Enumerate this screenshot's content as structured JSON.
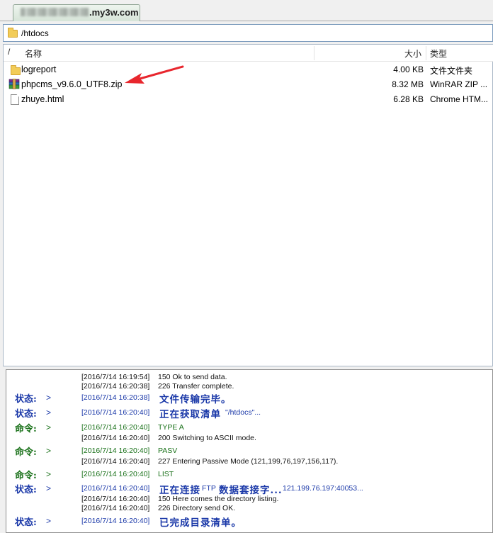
{
  "tab": {
    "label": ".my3w.com"
  },
  "pathbar": {
    "path": "/htdocs"
  },
  "filelist": {
    "sort_indicator": "/",
    "columns": {
      "name": "名称",
      "size": "大小",
      "type": "类型"
    },
    "rows": [
      {
        "name": "logreport",
        "size": "4.00 KB",
        "type": "文件文件夹",
        "icon": "folder-icon"
      },
      {
        "name": "phpcms_v9.6.0_UTF8.zip",
        "size": "8.32 MB",
        "type": "WinRAR ZIP ...",
        "icon": "rar-archive-icon"
      },
      {
        "name": "zhuye.html",
        "size": "6.28 KB",
        "type": "Chrome HTM...",
        "icon": "html-file-icon"
      }
    ]
  },
  "log": {
    "lines": [
      {
        "kind": "resp",
        "label": "",
        "gt": "",
        "time": "[2016/7/14 16:19:54]",
        "msg": "150 Ok to send data."
      },
      {
        "kind": "resp",
        "label": "",
        "gt": "",
        "time": "[2016/7/14 16:20:38]",
        "msg": "226 Transfer complete."
      },
      {
        "kind": "status",
        "label": "状态:",
        "gt": ">",
        "time": "[2016/7/14 16:20:38]",
        "msg": "文件传输完毕。"
      },
      {
        "kind": "status",
        "label": "状态:",
        "gt": ">",
        "time": "[2016/7/14 16:20:40]",
        "msg": "正在获取清单",
        "sub": "\"/htdocs\"..."
      },
      {
        "kind": "cmd",
        "label": "命令:",
        "gt": ">",
        "time": "[2016/7/14 16:20:40]",
        "msg": "TYPE A"
      },
      {
        "kind": "resp",
        "label": "",
        "gt": "",
        "time": "[2016/7/14 16:20:40]",
        "msg": "200 Switching to ASCII mode."
      },
      {
        "kind": "cmd",
        "label": "命令:",
        "gt": ">",
        "time": "[2016/7/14 16:20:40]",
        "msg": "PASV"
      },
      {
        "kind": "resp",
        "label": "",
        "gt": "",
        "time": "[2016/7/14 16:20:40]",
        "msg": "227 Entering Passive Mode (121,199,76,197,156,117)."
      },
      {
        "kind": "cmd",
        "label": "命令:",
        "gt": ">",
        "time": "[2016/7/14 16:20:40]",
        "msg": "LIST"
      },
      {
        "kind": "status",
        "label": "状态:",
        "gt": ">",
        "time": "[2016/7/14 16:20:40]",
        "msg": "正在连接",
        "sub": "FTP",
        "msg2": "数据套接字...",
        "sub2": "121.199.76.197:40053..."
      },
      {
        "kind": "resp",
        "label": "",
        "gt": "",
        "time": "[2016/7/14 16:20:40]",
        "msg": "150 Here comes the directory listing."
      },
      {
        "kind": "resp",
        "label": "",
        "gt": "",
        "time": "[2016/7/14 16:20:40]",
        "msg": "226 Directory send OK."
      },
      {
        "kind": "status",
        "label": "状态:",
        "gt": ">",
        "time": "[2016/7/14 16:20:40]",
        "msg": "已完成目录清单。"
      }
    ]
  },
  "colors": {
    "status": "#1a38a8",
    "command": "#187018",
    "response": "#111111",
    "arrow": "#e8262d"
  }
}
